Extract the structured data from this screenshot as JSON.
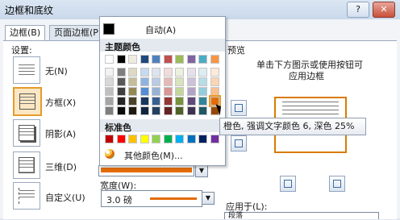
{
  "window": {
    "title": "边框和底纹",
    "help": "?",
    "close": "✕"
  },
  "tabs": [
    {
      "label": "边框(B)"
    },
    {
      "label": "页面边框(P)"
    }
  ],
  "settings": {
    "heading": "设置:",
    "items": [
      {
        "label": "无(N)"
      },
      {
        "label": "方框(X)"
      },
      {
        "label": "阴影(A)"
      },
      {
        "label": "三维(D)"
      },
      {
        "label": "自定义(U)"
      }
    ]
  },
  "preview": {
    "heading": "预览",
    "hint_line1": "单击下方图示或使用按钮可",
    "hint_line2": "应用边框"
  },
  "width": {
    "label": "宽度(W):",
    "value": "3.0 磅"
  },
  "apply_to": {
    "label": "应用于(L):",
    "value": "段落"
  },
  "color_popup": {
    "auto_label": "自动(A)",
    "theme_header": "主题颜色",
    "standard_header": "标准色",
    "more_label": "其他颜色(M)...",
    "theme_top": [
      "#ffffff",
      "#000000",
      "#eeece1",
      "#1f497d",
      "#4f81bd",
      "#c0504d",
      "#9bbb59",
      "#8064a2",
      "#4bacc6",
      "#f79646"
    ],
    "theme_shades": [
      [
        "#f2f2f2",
        "#7f7f7f",
        "#ddd9c3",
        "#c6d9f0",
        "#dbe5f1",
        "#f2dcdb",
        "#ebf1dd",
        "#e5e0ec",
        "#dbeef3",
        "#fdeada"
      ],
      [
        "#d8d8d8",
        "#595959",
        "#c4bd97",
        "#8db3e2",
        "#b8cce4",
        "#e5b9b7",
        "#d7e3bc",
        "#ccc1d9",
        "#b7dde8",
        "#fbd5b5"
      ],
      [
        "#bfbfbf",
        "#3f3f3f",
        "#938953",
        "#548dd4",
        "#95b3d7",
        "#d99694",
        "#c3d69b",
        "#b2a2c7",
        "#92cddc",
        "#fac08f"
      ],
      [
        "#a5a5a5",
        "#262626",
        "#494429",
        "#17365d",
        "#366092",
        "#953734",
        "#76923c",
        "#5f497a",
        "#31859b",
        "#e36c09"
      ],
      [
        "#7f7f7f",
        "#0c0c0c",
        "#1d1b10",
        "#0f243e",
        "#244061",
        "#632423",
        "#4f6128",
        "#3f3151",
        "#205867",
        "#974806"
      ]
    ],
    "standard": [
      "#c00000",
      "#ff0000",
      "#ffc000",
      "#ffff00",
      "#92d050",
      "#00b050",
      "#00b0f0",
      "#0070c0",
      "#002060",
      "#7030a0"
    ],
    "selected_color": "#e36c09"
  },
  "tooltip": {
    "text": "橙色, 强调文字颜色 6, 深色 25%"
  },
  "colors": {
    "accent": "#e36c09",
    "selection": "#e69b2c"
  }
}
